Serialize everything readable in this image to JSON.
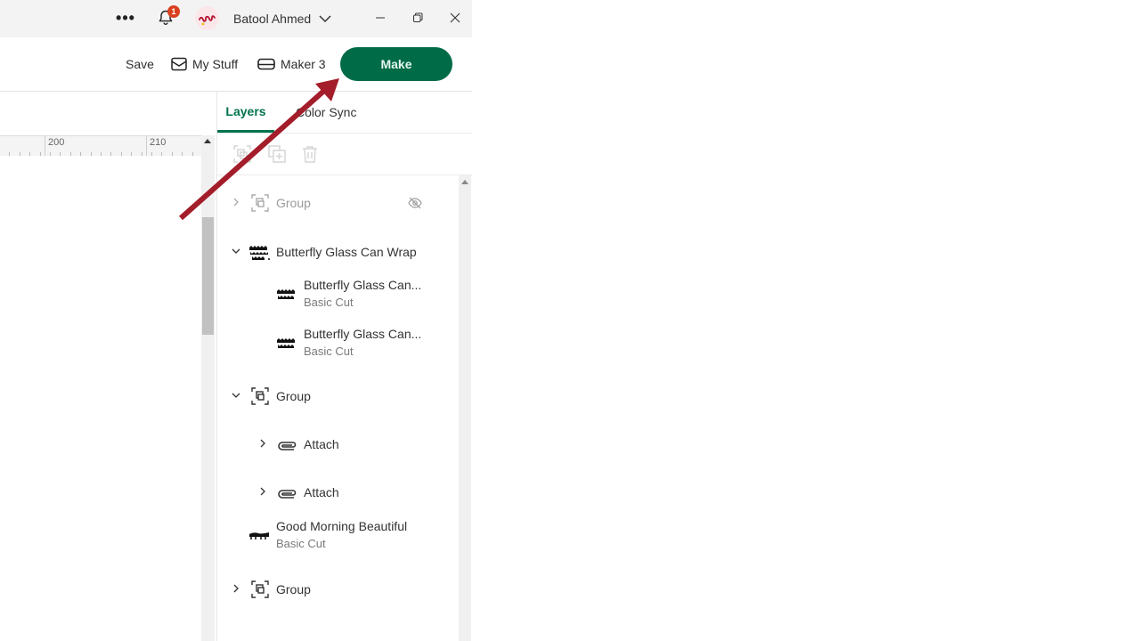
{
  "titlebar": {
    "more_icon": "more-horizontal-icon",
    "notification_count": "1",
    "user_name": "Batool Ahmed",
    "window_controls": [
      "minimize",
      "restore",
      "close"
    ]
  },
  "toolbar": {
    "save_label": "Save",
    "my_stuff_label": "My Stuff",
    "machine_label": "Maker 3",
    "make_label": "Make"
  },
  "canvas": {
    "ruler_labels": [
      "200",
      "210"
    ]
  },
  "panel": {
    "tabs": [
      {
        "label": "Layers",
        "active": true
      },
      {
        "label": "Color Sync",
        "active": false
      }
    ],
    "actions": [
      "group",
      "duplicate",
      "delete"
    ],
    "layers": [
      {
        "name": "Group",
        "type": "group",
        "expanded": false,
        "hidden": true
      },
      {
        "name": "Butterfly Glass Can Wrap",
        "type": "image",
        "expanded": true
      },
      {
        "name": "Butterfly Glass Can...",
        "sub": "Basic Cut",
        "type": "cut",
        "indent": 1
      },
      {
        "name": "Butterfly Glass Can...",
        "sub": "Basic Cut",
        "type": "cut",
        "indent": 1
      },
      {
        "name": "Group",
        "type": "group",
        "expanded": true
      },
      {
        "name": "Attach",
        "type": "attach",
        "expanded": false,
        "indent": 1
      },
      {
        "name": "Attach",
        "type": "attach",
        "expanded": false,
        "indent": 1
      },
      {
        "name": "Good Morning Beautiful",
        "sub": "Basic Cut",
        "type": "cut"
      },
      {
        "name": "Group",
        "type": "group",
        "expanded": false
      }
    ]
  },
  "colors": {
    "accent": "#006b47",
    "annotation_arrow": "#a31d2a",
    "badge": "#d9411e"
  }
}
